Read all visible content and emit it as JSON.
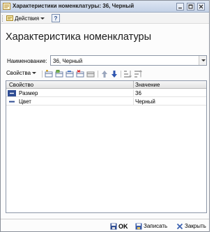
{
  "window": {
    "title": "Характеристики номенклатуры: 36, Черный"
  },
  "menubar": {
    "actions_label": "Действия",
    "help_label": "?"
  },
  "form": {
    "heading": "Характеристика номенклатуры",
    "name_label": "Наименование:",
    "name_value": "36, Черный"
  },
  "table_toolbar": {
    "properties_label": "Свойства"
  },
  "table": {
    "columns": [
      "Свойство",
      "Значение"
    ],
    "rows": [
      {
        "property": "Размер",
        "value": "36",
        "selected": true
      },
      {
        "property": "Цвет",
        "value": "Черный",
        "selected": false
      }
    ]
  },
  "footer": {
    "ok_label": "OK",
    "save_label": "Записать",
    "close_label": "Закрыть"
  },
  "colors": {
    "titlebar": "#c3d1e6",
    "selection": "#2f4d93",
    "ok_icon": "#2f4d93",
    "close_icon": "#3d63b0"
  }
}
